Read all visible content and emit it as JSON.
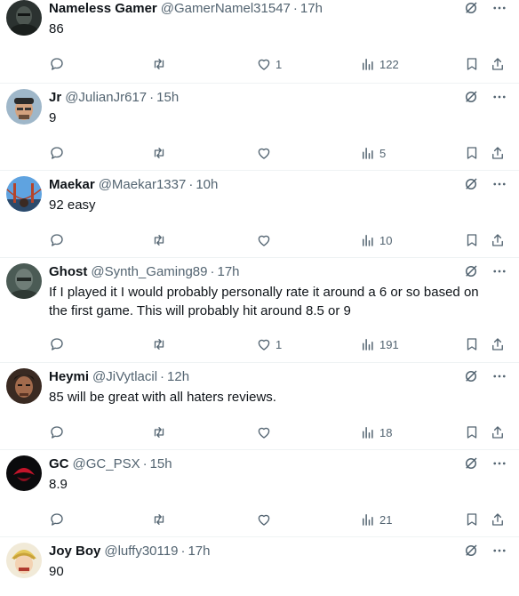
{
  "replies": [
    {
      "name": "Nameless Gamer",
      "handle": "@GamerNamel31547",
      "time": "17h",
      "text": "86",
      "likes": "1",
      "views": "122",
      "avatar": "dark-character"
    },
    {
      "name": "Jr",
      "handle": "@JulianJr617",
      "time": "15h",
      "text": "9",
      "likes": "",
      "views": "5",
      "avatar": "man-cap"
    },
    {
      "name": "Maekar",
      "handle": "@Maekar1337",
      "time": "10h",
      "text": "92 easy",
      "likes": "",
      "views": "10",
      "avatar": "bridge-photo"
    },
    {
      "name": "Ghost",
      "handle": "@Synth_Gaming89",
      "time": "17h",
      "text": "If I played it I would probably personally rate it around a 6 or so based on the first game. This will probably hit around 8.5 or 9",
      "likes": "1",
      "views": "191",
      "avatar": "knight"
    },
    {
      "name": "Heymi",
      "handle": "@JiVytlacil",
      "time": "12h",
      "text": "85 will be great with all haters reviews.",
      "likes": "",
      "views": "18",
      "avatar": "fighter"
    },
    {
      "name": "GC",
      "handle": "@GC_PSX",
      "time": "15h",
      "text": "8.9",
      "likes": "",
      "views": "21",
      "avatar": "red-logo"
    },
    {
      "name": "Joy Boy",
      "handle": "@luffy30119",
      "time": "17h",
      "text": "90",
      "likes": "",
      "views": "",
      "avatar": "anime-character"
    }
  ],
  "separator": "·",
  "colors": {
    "text": "#0f1419",
    "muted": "#536471",
    "border": "#eff3f4"
  }
}
